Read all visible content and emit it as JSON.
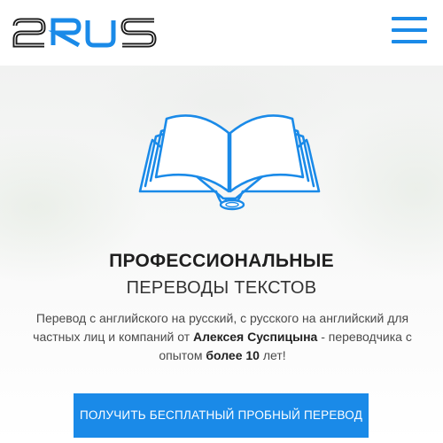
{
  "header": {
    "logo_text": "2RUS",
    "menu_icon": "hamburger-menu-icon"
  },
  "hero": {
    "illustration_icon": "open-book-icon",
    "title_bold": "ПРОФЕССИОНАЛЬНЫЕ",
    "title_light": "ПЕРЕВОДЫ ТЕКСТОВ",
    "description": {
      "part1": "Перевод с английского на русский, с русского на английский для частных лиц и компаний от ",
      "name": "Алексея Суспицына",
      "part2": " - переводчика с опытом ",
      "experience": "более 10",
      "part3": " лет!"
    },
    "cta_label": "ПОЛУЧИТЬ БЕСПЛАТНЫЙ ПРОБНЫЙ ПЕРЕВОД"
  },
  "colors": {
    "accent": "#1a8ae8",
    "text_dark": "#1f1f1f",
    "text_body": "#4a4a4a"
  }
}
